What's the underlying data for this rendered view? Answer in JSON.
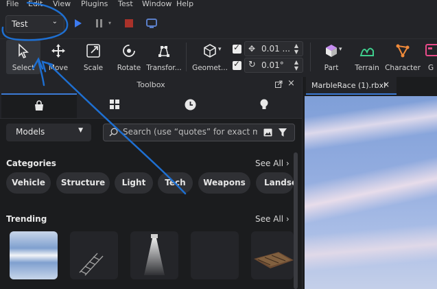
{
  "menu": [
    "File",
    "Edit",
    "View",
    "Plugins",
    "Test",
    "Window",
    "Help"
  ],
  "mode_select": {
    "value": "Test"
  },
  "tools": {
    "select": "Select",
    "move": "Move",
    "scale": "Scale",
    "rotate": "Rotate",
    "transform": "Transfor...",
    "geometry": "Geomet...",
    "part": "Part",
    "terrain": "Terrain",
    "character": "Character",
    "more": "G"
  },
  "snapping": {
    "move_value": "0.01 ...",
    "rotate_value": "0.01°"
  },
  "toolbox": {
    "title": "Toolbox",
    "category_select": "Models",
    "search_placeholder": "Search (use “quotes” for exact match)",
    "categories_title": "Categories",
    "trending_title": "Trending",
    "see_all": "See All",
    "categories": [
      "Vehicle",
      "Structure",
      "Light",
      "Tech",
      "Weapons",
      "Landscape"
    ]
  },
  "document_tab": {
    "label": "MarbleRace (1).rbxl"
  },
  "colors": {
    "accent": "#3b7bd6",
    "annotation": "#1e6fd1",
    "play": "#3d7bf0",
    "stop": "#c0392b"
  }
}
